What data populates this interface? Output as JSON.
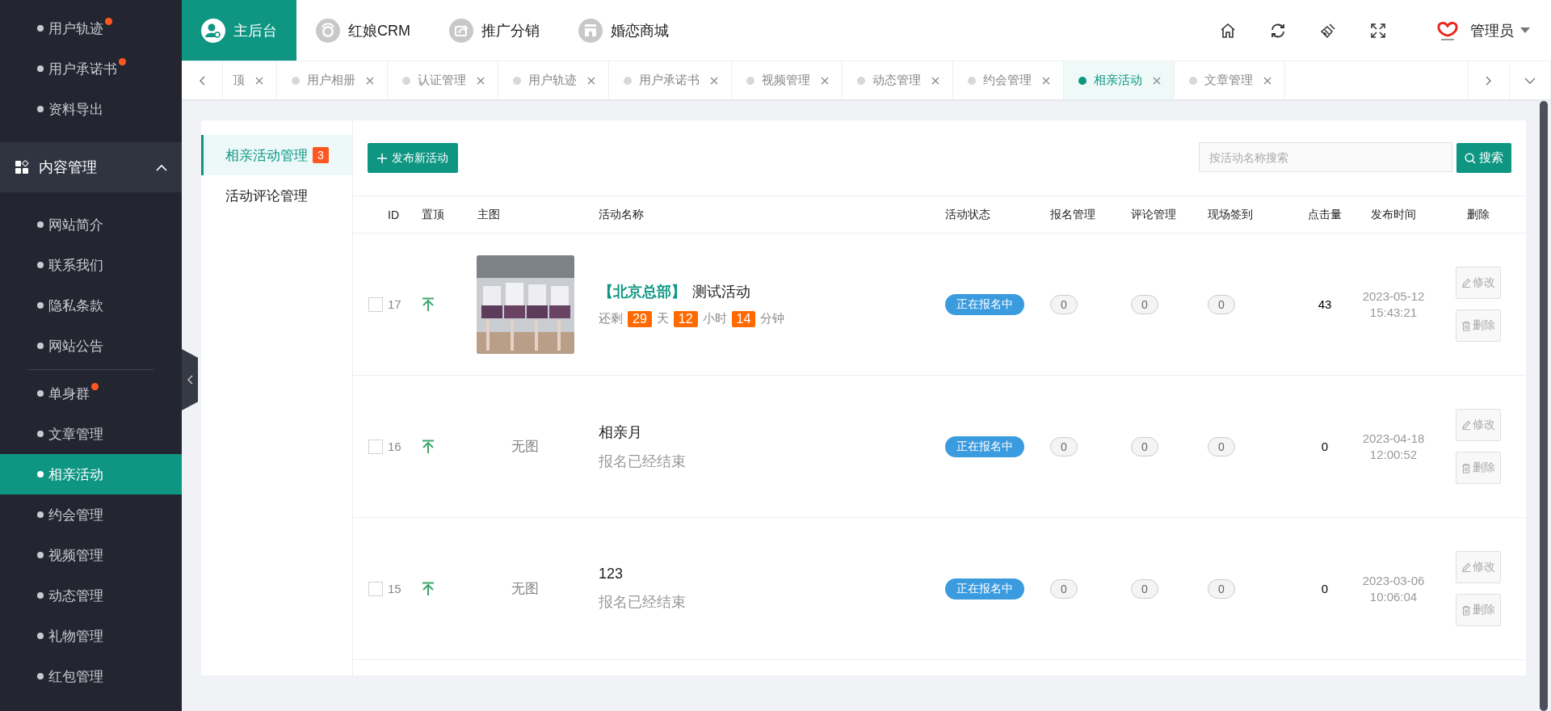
{
  "sidebar": {
    "top_items": [
      {
        "label": "用户轨迹",
        "badge": true,
        "selected": false
      },
      {
        "label": "用户承诺书",
        "badge": true,
        "selected": false
      },
      {
        "label": "资料导出",
        "badge": false,
        "selected": false
      }
    ],
    "group": {
      "label": "内容管理",
      "expanded": true,
      "items": [
        {
          "label": "网站简介",
          "badge": false,
          "selected": false
        },
        {
          "label": "联系我们",
          "badge": false,
          "selected": false
        },
        {
          "label": "隐私条款",
          "badge": false,
          "selected": false
        },
        {
          "label": "网站公告",
          "badge": false,
          "selected": false
        },
        {
          "kind": "divider"
        },
        {
          "label": "单身群",
          "badge": true,
          "selected": false
        },
        {
          "label": "文章管理",
          "badge": false,
          "selected": false
        },
        {
          "label": "相亲活动",
          "badge": false,
          "selected": true
        },
        {
          "label": "约会管理",
          "badge": false,
          "selected": false
        },
        {
          "label": "视频管理",
          "badge": false,
          "selected": false
        },
        {
          "label": "动态管理",
          "badge": false,
          "selected": false
        },
        {
          "label": "礼物管理",
          "badge": false,
          "selected": false
        },
        {
          "label": "红包管理",
          "badge": false,
          "selected": false
        }
      ]
    }
  },
  "top_nav": [
    {
      "label": "主后台",
      "selected": true
    },
    {
      "label": "红娘CRM",
      "selected": false
    },
    {
      "label": "推广分销",
      "selected": false
    },
    {
      "label": "婚恋商城",
      "selected": false
    }
  ],
  "user": {
    "name": "管理员"
  },
  "tabs": [
    {
      "label": "顶",
      "cut": true,
      "selected": false
    },
    {
      "label": "用户相册",
      "cut": false,
      "selected": false
    },
    {
      "label": "认证管理",
      "cut": false,
      "selected": false
    },
    {
      "label": "用户轨迹",
      "cut": false,
      "selected": false
    },
    {
      "label": "用户承诺书",
      "cut": false,
      "selected": false
    },
    {
      "label": "视频管理",
      "cut": false,
      "selected": false
    },
    {
      "label": "动态管理",
      "cut": false,
      "selected": false
    },
    {
      "label": "约会管理",
      "cut": false,
      "selected": false
    },
    {
      "label": "相亲活动",
      "cut": false,
      "selected": true
    },
    {
      "label": "文章管理",
      "cut": false,
      "selected": false
    }
  ],
  "subnav": [
    {
      "label": "相亲活动管理",
      "count": "3",
      "selected": true
    },
    {
      "label": "活动评论管理",
      "selected": false
    }
  ],
  "toolbar": {
    "add_button": "发布新活动",
    "search": {
      "placeholder": "按活动名称搜索"
    },
    "search_button": "搜索"
  },
  "table": {
    "columns": [
      "ID",
      "置顶",
      "主图",
      "活动名称",
      "活动状态",
      "报名管理",
      "评论管理",
      "现场签到",
      "点击量",
      "发布时间",
      "删除"
    ],
    "rows": [
      {
        "checked": false,
        "id": "17",
        "branch": "【北京总部】",
        "title": "测试活动",
        "countdown": [
          {
            "kind": "text",
            "text": "还剩"
          },
          {
            "kind": "number",
            "text": "29"
          },
          {
            "kind": "text",
            "text": "天"
          },
          {
            "kind": "number",
            "text": "12"
          },
          {
            "kind": "text",
            "text": "小时"
          },
          {
            "kind": "number",
            "text": "14"
          },
          {
            "kind": "text",
            "text": "分钟"
          }
        ],
        "status": "正在报名中",
        "signups": "0",
        "comments": "0",
        "checkins": "0",
        "clicks": "43",
        "date": "2023-05-12",
        "time": "15:43:21",
        "edit": "修改",
        "delete": "删除"
      },
      {
        "checked": false,
        "id": "16",
        "image": {
          "kind": "none",
          "text": "无图"
        },
        "title": "相亲月",
        "note": "报名已经结束",
        "status": "正在报名中",
        "signups": "0",
        "comments": "0",
        "checkins": "0",
        "clicks": "0",
        "date": "2023-04-18",
        "time": "12:00:52",
        "edit": "修改",
        "delete": "删除"
      },
      {
        "checked": false,
        "id": "15",
        "image": {
          "kind": "none",
          "text": "无图"
        },
        "title": "123",
        "note": "报名已经结束",
        "status": "正在报名中",
        "signups": "0",
        "comments": "0",
        "checkins": "0",
        "clicks": "0",
        "date": "2023-03-06",
        "time": "10:06:04",
        "edit": "修改",
        "delete": "删除"
      }
    ]
  }
}
